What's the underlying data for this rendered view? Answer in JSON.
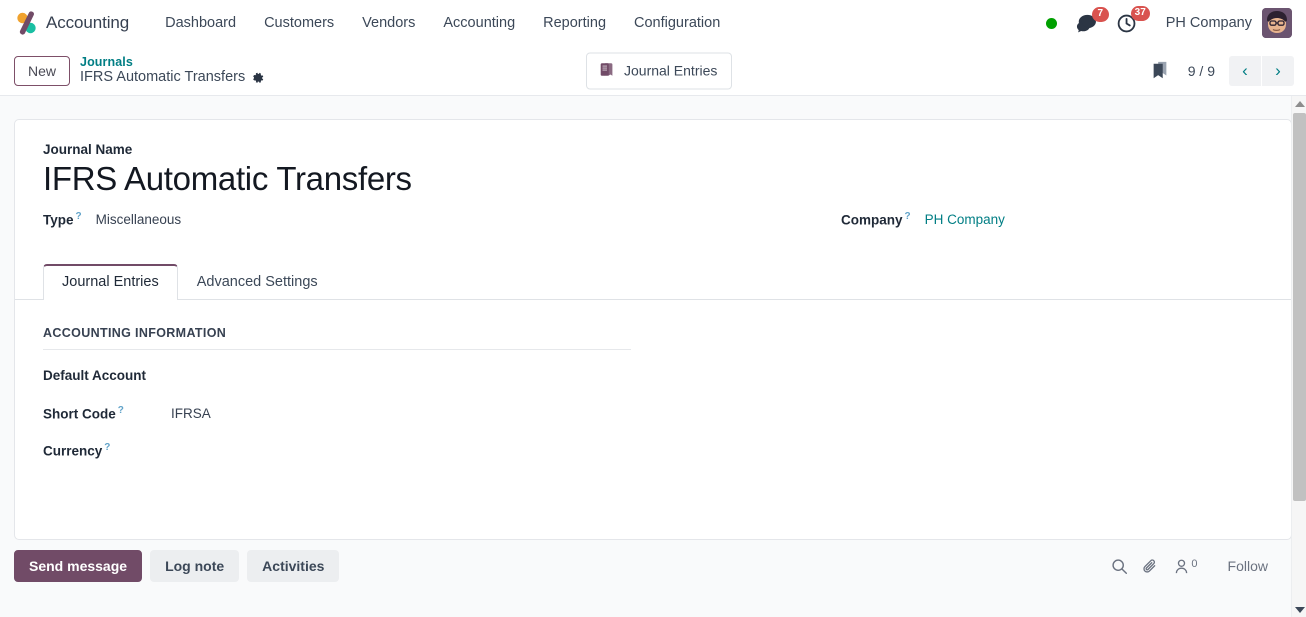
{
  "navbar": {
    "brand": "Accounting",
    "logo_colors": {
      "slash": "#714B67",
      "circle_top": "#F0A22E",
      "circle_bottom": "#1ABFA3"
    },
    "menu": [
      {
        "label": "Dashboard"
      },
      {
        "label": "Customers"
      },
      {
        "label": "Vendors"
      },
      {
        "label": "Accounting"
      },
      {
        "label": "Reporting"
      },
      {
        "label": "Configuration"
      }
    ],
    "status_indicator": {
      "name": "online-status-dot",
      "color": "#00a000"
    },
    "messages": {
      "icon": "chat-icon",
      "count": "7",
      "badge_color": "#d9534f"
    },
    "activities": {
      "icon": "clock-icon",
      "count": "37",
      "badge_color": "#d9534f"
    },
    "company": "PH Company",
    "avatar": {
      "name": "user-avatar"
    }
  },
  "control_panel": {
    "new_button": "New",
    "breadcrumb_parent": "Journals",
    "breadcrumb_current": "IFRS Automatic Transfers",
    "gear_icon": "gear-icon",
    "smart_button": {
      "label": "Journal Entries",
      "icon": "book-icon"
    },
    "bookmark_icon": "bookmark-icon",
    "pager": {
      "value": "9 / 9",
      "prev": "‹",
      "next": "›"
    }
  },
  "form": {
    "journal_name_label": "Journal Name",
    "journal_name_value": "IFRS Automatic Transfers",
    "type_label": "Type",
    "type_value": "Miscellaneous",
    "company_label": "Company",
    "company_value": "PH Company",
    "help_marker": "?",
    "tabs": [
      {
        "label": "Journal Entries",
        "active": true
      },
      {
        "label": "Advanced Settings",
        "active": false
      }
    ],
    "accounting_section": {
      "title": "ACCOUNTING INFORMATION",
      "fields": [
        {
          "label": "Default Account",
          "value": "",
          "has_help": false
        },
        {
          "label": "Short Code",
          "value": "IFRSA",
          "has_help": true
        },
        {
          "label": "Currency",
          "value": "",
          "has_help": true
        }
      ]
    }
  },
  "chatter": {
    "send_message": "Send message",
    "log_note": "Log note",
    "activities": "Activities",
    "search_icon": "search-icon",
    "attachment_icon": "paperclip-icon",
    "followers_icon": "followers-icon",
    "followers_count": "0",
    "follow_label": "Follow"
  }
}
